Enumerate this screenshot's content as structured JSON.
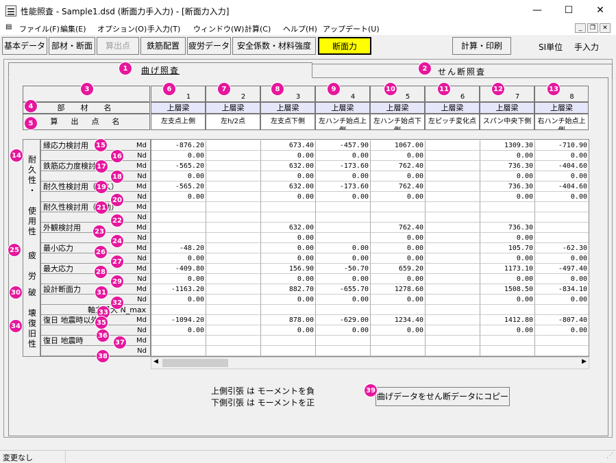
{
  "window": {
    "title": "性能照査 - Sample1.dsd (断面力手入力) - [断面力入力]",
    "minimize": "—",
    "maximize": "☐",
    "close": "✕"
  },
  "menu": [
    "ファイル(F)",
    "編集(E)",
    "オプション(O)",
    "手入力(T)",
    "ウィンドウ(W)",
    "計算(C)",
    "ヘルプ(H)",
    "アップデート(U)"
  ],
  "mdi": {
    "minimize": "_",
    "restore": "❐",
    "close": "✕"
  },
  "toolbar": {
    "buttons": [
      "基本データ",
      "部材・断面",
      "算出点",
      "鉄筋配置",
      "疲労データ",
      "安全係数・材料強度",
      "断面力",
      "計算・印刷"
    ],
    "units": "SI単位",
    "mode": "手入力"
  },
  "tabs": {
    "bending": "曲げ照査",
    "shear": "せん断照査"
  },
  "columns": [
    {
      "no": "1",
      "member": "上層梁",
      "point": "左支点上側"
    },
    {
      "no": "2",
      "member": "上層梁",
      "point": "左h/2点"
    },
    {
      "no": "3",
      "member": "上層梁",
      "point": "左支点下側"
    },
    {
      "no": "4",
      "member": "上層梁",
      "point": "左ハンチ始点上側"
    },
    {
      "no": "5",
      "member": "上層梁",
      "point": "左ハンチ始点下側"
    },
    {
      "no": "6",
      "member": "上層梁",
      "point": "左ピッチ変化点"
    },
    {
      "no": "7",
      "member": "上層梁",
      "point": "スパン中央下側"
    },
    {
      "no": "8",
      "member": "上層梁",
      "point": "右ハンチ始点上側"
    }
  ],
  "header_labels": {
    "member": "部　材　名",
    "point": "算　出　点　名"
  },
  "groups": {
    "durability": "耐久性・使用性",
    "fatigue": "疲労",
    "failure": "破壊",
    "restoration": "復旧性"
  },
  "rows": [
    {
      "label": "縁応力検討用",
      "unit": "Md",
      "values": [
        "-876.20",
        "",
        "673.40",
        "-457.90",
        "1067.00",
        "",
        "1309.30",
        "-710.90"
      ]
    },
    {
      "label": "",
      "unit": "Nd",
      "values": [
        "0.00",
        "",
        "0.00",
        "0.00",
        "0.00",
        "",
        "0.00",
        "0.00"
      ]
    },
    {
      "label": "鉄筋応力度検討用",
      "unit": "Md",
      "values": [
        "-565.20",
        "",
        "632.00",
        "-173.60",
        "762.40",
        "",
        "736.30",
        "-404.60"
      ]
    },
    {
      "label": "",
      "unit": "Nd",
      "values": [
        "0.00",
        "",
        "0.00",
        "0.00",
        "0.00",
        "",
        "0.00",
        "0.00"
      ]
    },
    {
      "label": "耐久性検討用（永久）",
      "unit": "Md",
      "values": [
        "-565.20",
        "",
        "632.00",
        "-173.60",
        "762.40",
        "",
        "736.30",
        "-404.60"
      ]
    },
    {
      "label": "",
      "unit": "Nd",
      "values": [
        "0.00",
        "",
        "0.00",
        "0.00",
        "0.00",
        "",
        "0.00",
        "0.00"
      ]
    },
    {
      "label": "耐久性検討用（変動）",
      "unit": "Md",
      "values": [
        "",
        "",
        "",
        "",
        "",
        "",
        "",
        ""
      ]
    },
    {
      "label": "",
      "unit": "Nd",
      "values": [
        "",
        "",
        "",
        "",
        "",
        "",
        "",
        ""
      ]
    },
    {
      "label": "外観検討用",
      "unit": "Md",
      "values": [
        "",
        "",
        "632.00",
        "",
        "762.40",
        "",
        "736.30",
        ""
      ]
    },
    {
      "label": "",
      "unit": "Nd",
      "values": [
        "",
        "",
        "0.00",
        "",
        "0.00",
        "",
        "0.00",
        ""
      ]
    },
    {
      "label": "最小応力",
      "unit": "Md",
      "values": [
        "-48.20",
        "",
        "0.00",
        "0.00",
        "0.00",
        "",
        "105.70",
        "-62.30"
      ]
    },
    {
      "label": "",
      "unit": "Nd",
      "values": [
        "0.00",
        "",
        "0.00",
        "0.00",
        "0.00",
        "",
        "0.00",
        "0.00"
      ]
    },
    {
      "label": "最大応力",
      "unit": "Md",
      "values": [
        "-409.80",
        "",
        "156.90",
        "-50.70",
        "659.20",
        "",
        "1173.10",
        "-497.40"
      ]
    },
    {
      "label": "",
      "unit": "Nd",
      "values": [
        "0.00",
        "",
        "0.00",
        "0.00",
        "0.00",
        "",
        "0.00",
        "0.00"
      ]
    },
    {
      "label": "設計断面力",
      "unit": "Md",
      "values": [
        "-1163.20",
        "",
        "882.70",
        "-655.70",
        "1278.60",
        "",
        "1508.50",
        "-834.10"
      ]
    },
    {
      "label": "",
      "unit": "Nd",
      "values": [
        "0.00",
        "",
        "0.00",
        "0.00",
        "0.00",
        "",
        "0.00",
        "0.00"
      ]
    },
    {
      "label": "軸力最大 N_max",
      "unit": "",
      "values": [
        "",
        "",
        "",
        "",
        "",
        "",
        "",
        ""
      ]
    },
    {
      "label": "復日 地震時以外",
      "unit": "Md",
      "values": [
        "-1094.20",
        "",
        "878.00",
        "-629.00",
        "1234.40",
        "",
        "1412.80",
        "-807.40"
      ]
    },
    {
      "label": "",
      "unit": "Nd",
      "values": [
        "0.00",
        "",
        "0.00",
        "0.00",
        "0.00",
        "",
        "0.00",
        "0.00"
      ]
    },
    {
      "label": "復日 地震時",
      "unit": "Md",
      "values": [
        "",
        "",
        "",
        "",
        "",
        "",
        "",
        ""
      ]
    },
    {
      "label": "",
      "unit": "Nd",
      "values": [
        "",
        "",
        "",
        "",
        "",
        "",
        "",
        ""
      ]
    }
  ],
  "notes": {
    "line1": "上側引張 は モーメントを負",
    "line2": "下側引張 は モーメントを正"
  },
  "copy_button": "曲げデータをせん断データにコピー",
  "status": "変更なし",
  "badges": [
    "1",
    "2",
    "3",
    "4",
    "5",
    "6",
    "7",
    "8",
    "9",
    "10",
    "11",
    "12",
    "13",
    "14",
    "15",
    "16",
    "17",
    "18",
    "19",
    "20",
    "21",
    "22",
    "23",
    "24",
    "25",
    "26",
    "27",
    "28",
    "29",
    "30",
    "31",
    "32",
    "33",
    "34",
    "35",
    "36",
    "37",
    "38",
    "39"
  ],
  "colors": {
    "active_button": "#ffff00",
    "member_cell": "#e6e6fa",
    "badge": "#e6179c"
  }
}
